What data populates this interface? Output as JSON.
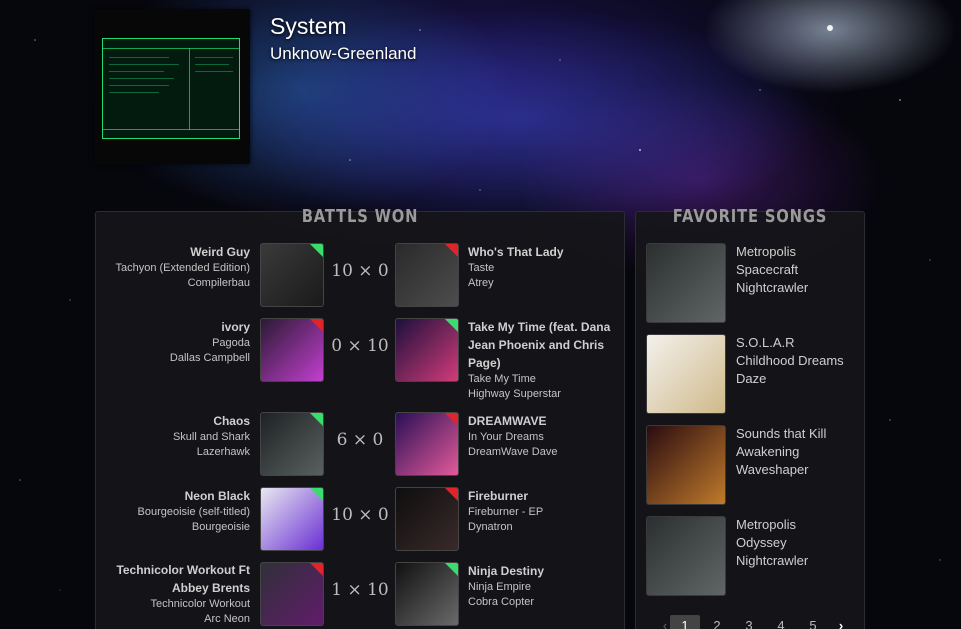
{
  "artist": {
    "name": "System",
    "subtitle": "Unknow-Greenland"
  },
  "battles": {
    "title": "BATTLS WON",
    "rows": [
      {
        "left": {
          "title": "Weird Guy",
          "album": "Tachyon (Extended Edition)",
          "artist": "Compilerbau",
          "corner": "green"
        },
        "score": "10 × 0",
        "right": {
          "title": "Who's That Lady",
          "album": "Taste",
          "artist": "Atrey",
          "corner": "red"
        }
      },
      {
        "left": {
          "title": "ivory",
          "album": "Pagoda",
          "artist": "Dallas Campbell",
          "corner": "red"
        },
        "score": "0 × 10",
        "right": {
          "title": "Take My Time (feat. Dana Jean Phoenix and Chris Page)",
          "album": "Take My Time",
          "artist": "Highway Superstar",
          "corner": "green"
        }
      },
      {
        "left": {
          "title": "Chaos",
          "album": "Skull and Shark",
          "artist": "Lazerhawk",
          "corner": "green"
        },
        "score": "6 × 0",
        "right": {
          "title": "DREAMWAVE",
          "album": "In Your Dreams",
          "artist": "DreamWave Dave",
          "corner": "red"
        }
      },
      {
        "left": {
          "title": "Neon Black",
          "album": "Bourgeoisie (self-titled)",
          "artist": "Bourgeoisie",
          "corner": "green"
        },
        "score": "10 × 0",
        "right": {
          "title": "Fireburner",
          "album": "Fireburner - EP",
          "artist": "Dynatron",
          "corner": "red"
        }
      },
      {
        "left": {
          "title": "Technicolor Workout Ft Abbey Brents",
          "album": "Technicolor Workout",
          "artist": "Arc Neon",
          "corner": "red"
        },
        "score": "1 × 10",
        "right": {
          "title": "Ninja Destiny",
          "album": "Ninja Empire",
          "artist": "Cobra Copter",
          "corner": "green"
        }
      }
    ]
  },
  "favorites": {
    "title": "FAVORITE SONGS",
    "items": [
      {
        "title": "Metropolis",
        "album": "Spacecraft",
        "artist": "Nightcrawler"
      },
      {
        "title": "S.O.L.A.R",
        "album": "Childhood Dreams",
        "artist": "Daze"
      },
      {
        "title": "Sounds that Kill",
        "album": "Awakening",
        "artist": "Waveshaper"
      },
      {
        "title": "Metropolis",
        "album": "Odyssey",
        "artist": "Nightcrawler"
      }
    ]
  },
  "pagination": {
    "pages": [
      "1",
      "2",
      "3",
      "4",
      "5"
    ],
    "active": "1",
    "next_icon": "chevron-right-icon",
    "prev_icon": "chevron-left-icon"
  },
  "colors": {
    "win": "#3bdc6e",
    "loss": "#e0242c"
  }
}
